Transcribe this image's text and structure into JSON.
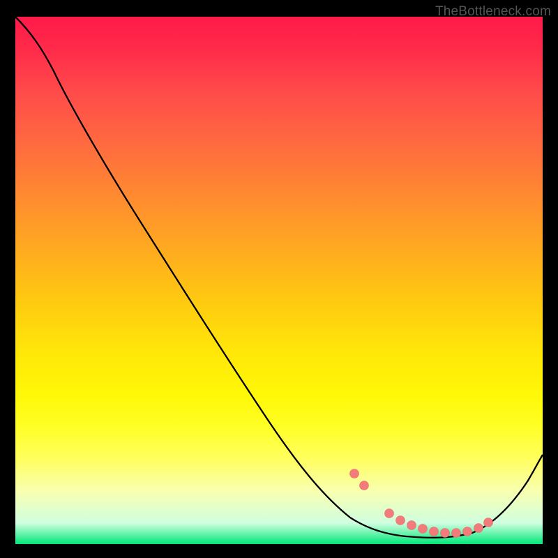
{
  "attribution": "TheBottleneck.com",
  "chart_data": {
    "type": "line",
    "title": "",
    "xlabel": "",
    "ylabel": "",
    "xlim": [
      0,
      100
    ],
    "ylim": [
      0,
      100
    ],
    "x": [
      0,
      3,
      6,
      10,
      15,
      20,
      25,
      30,
      35,
      40,
      45,
      50,
      55,
      60,
      63,
      66,
      70,
      74,
      78,
      82,
      86,
      90,
      94,
      97,
      100
    ],
    "values": [
      100,
      97,
      93,
      88,
      81,
      74,
      67,
      60,
      53,
      46,
      39,
      32.5,
      26,
      19.5,
      15.5,
      11.5,
      7,
      4,
      2.2,
      1.4,
      1.4,
      2.4,
      5,
      9,
      14
    ],
    "markers_x": [
      64,
      66,
      71,
      73,
      75,
      77,
      79,
      81,
      83,
      85,
      87,
      89
    ],
    "markers_y": [
      13,
      11,
      5.5,
      4.3,
      3.5,
      2.8,
      2.2,
      2,
      2,
      2.2,
      2.8,
      3.8
    ],
    "background": "gradient-red-to-green",
    "line_color": "#000000",
    "marker_color": "#f27c7c"
  }
}
